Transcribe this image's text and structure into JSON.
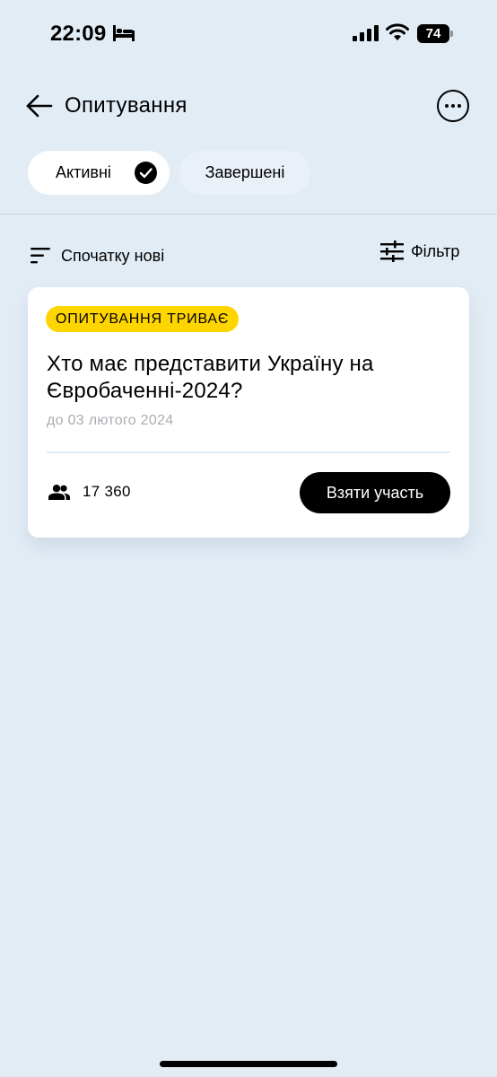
{
  "status_bar": {
    "time": "22:09",
    "battery_level": "74",
    "icons": [
      "bed-icon",
      "signal-icon",
      "wifi-icon",
      "battery-icon"
    ]
  },
  "header": {
    "title": "Опитування",
    "back_icon": "arrow-left-icon",
    "more_icon": "more-horizontal-icon"
  },
  "tabs": [
    {
      "label": "Активні",
      "selected": true,
      "icon": "check-circle-icon"
    },
    {
      "label": "Завершені",
      "selected": false
    }
  ],
  "sort": {
    "label": "Спочатку нові",
    "icon": "sort-icon"
  },
  "filter": {
    "label": "Фільтр",
    "icon": "sliders-icon"
  },
  "polls": [
    {
      "status": "ОПИТУВАННЯ ТРИВАЄ",
      "title": "Хто має представити Україну на Євробаченні-2024?",
      "deadline": "до 03 лютого 2024",
      "participants": "17 360",
      "action_label": "Взяти участь"
    }
  ],
  "colors": {
    "background": "#e2ecf5",
    "badge": "#ffd500",
    "button": "#000000",
    "deadline_text": "#a9adb1"
  }
}
